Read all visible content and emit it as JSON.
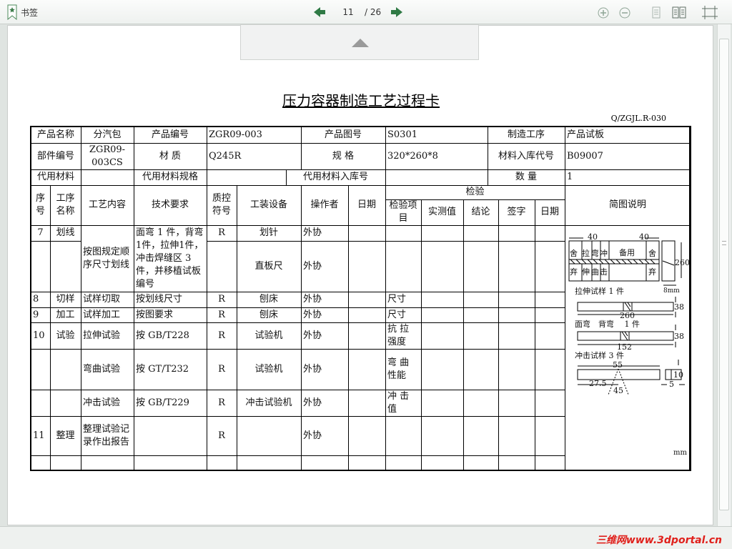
{
  "toolbar": {
    "bookmark_label": "书签",
    "current_page": "11",
    "total_pages": "/ 26"
  },
  "document": {
    "title": "压力容器制造工艺过程卡",
    "doc_code": "Q/ZGJL.R-030",
    "info": {
      "r1": [
        "产品名称",
        "分汽包",
        "产品编号",
        "ZGR09-003",
        "产品图号",
        "S0301",
        "制造工序",
        "产品试板"
      ],
      "r2": [
        "部件编号",
        "ZGR09-003CS",
        "材 质",
        "Q245R",
        "规 格",
        "320*260*8",
        "材料入库代号",
        "B09007"
      ],
      "r3": [
        "代用材料",
        "",
        "代用材料规格",
        "",
        "代用材料入库号",
        "",
        "数 量",
        "1"
      ]
    },
    "headers": {
      "seq": "序号",
      "step_name": "工序名称",
      "content": "工艺内容",
      "tech_req": "技术要求",
      "qc": "质控符号",
      "tooling": "工装设备",
      "operator": "操作者",
      "date": "日期",
      "inspection": "检验",
      "insp_item": "检验项目",
      "measured": "实测值",
      "conclusion": "结论",
      "signature": "签字",
      "insp_date": "日期",
      "sketch": "简图说明"
    },
    "rows": {
      "r7": {
        "seq": "7",
        "name": "划线",
        "content": "按图规定顺序尺寸划线",
        "tech": "面弯 1 件，背弯1件，拉伸1件，冲击焊缝区 3 件，并移植试板编号",
        "qc": "R",
        "tool1": "划针",
        "tool2": "直板尺",
        "op1": "外协",
        "op2": "外协"
      },
      "r8": {
        "seq": "8",
        "name": "切样",
        "content": "试样切取",
        "tech": "按划线尺寸",
        "qc": "R",
        "tool": "刨床",
        "op": "外协",
        "item": "尺寸"
      },
      "r9": {
        "seq": "9",
        "name": "加工",
        "content": "试样加工",
        "tech": "按图要求",
        "qc": "R",
        "tool": "刨床",
        "op": "外协",
        "item": "尺寸"
      },
      "r10a": {
        "seq": "10",
        "name": "试验",
        "content": "拉伸试验",
        "tech": "按 GB/T228",
        "qc": "R",
        "tool": "试验机",
        "op": "外协",
        "item": "抗 拉 强度"
      },
      "r10b": {
        "content": "弯曲试验",
        "tech": "按 GT/T232",
        "qc": "R",
        "tool": "试验机",
        "op": "外协",
        "item": "弯 曲 性能"
      },
      "r10c": {
        "content": "冲击试验",
        "tech": "按 GB/T229",
        "qc": "R",
        "tool": "冲击试验机",
        "op": "外协",
        "item": "冲 击 值"
      },
      "r11": {
        "seq": "11",
        "name": "整理",
        "content": "整理试验记录作出报告",
        "qc": "R",
        "op": "外协"
      }
    },
    "sketch": {
      "d40a": "40",
      "d40b": "40",
      "she1": "舍",
      "la": "拉",
      "wan": "弯",
      "chong": "冲",
      "beiyong": "备用",
      "she2": "舍",
      "qi1": "弃",
      "shen": "伸",
      "qu": "曲",
      "ji": "击",
      "qi2": "弃",
      "d260": "260",
      "d8mm": "8mm",
      "tensile": "拉伸试样 1 件",
      "t38": "38",
      "t260": "260",
      "bend": "面弯　背弯　 1 件",
      "b38": "38",
      "b152": "152",
      "impact": "冲击试样 3 件",
      "i55": "55",
      "i10": "10",
      "i275": "27.5",
      "i5": "5",
      "i45": "45",
      "unit": "mm"
    }
  },
  "footer": {
    "watermark": "三维网www.3dportal.cn",
    "watermark_color": "#e0201b"
  }
}
